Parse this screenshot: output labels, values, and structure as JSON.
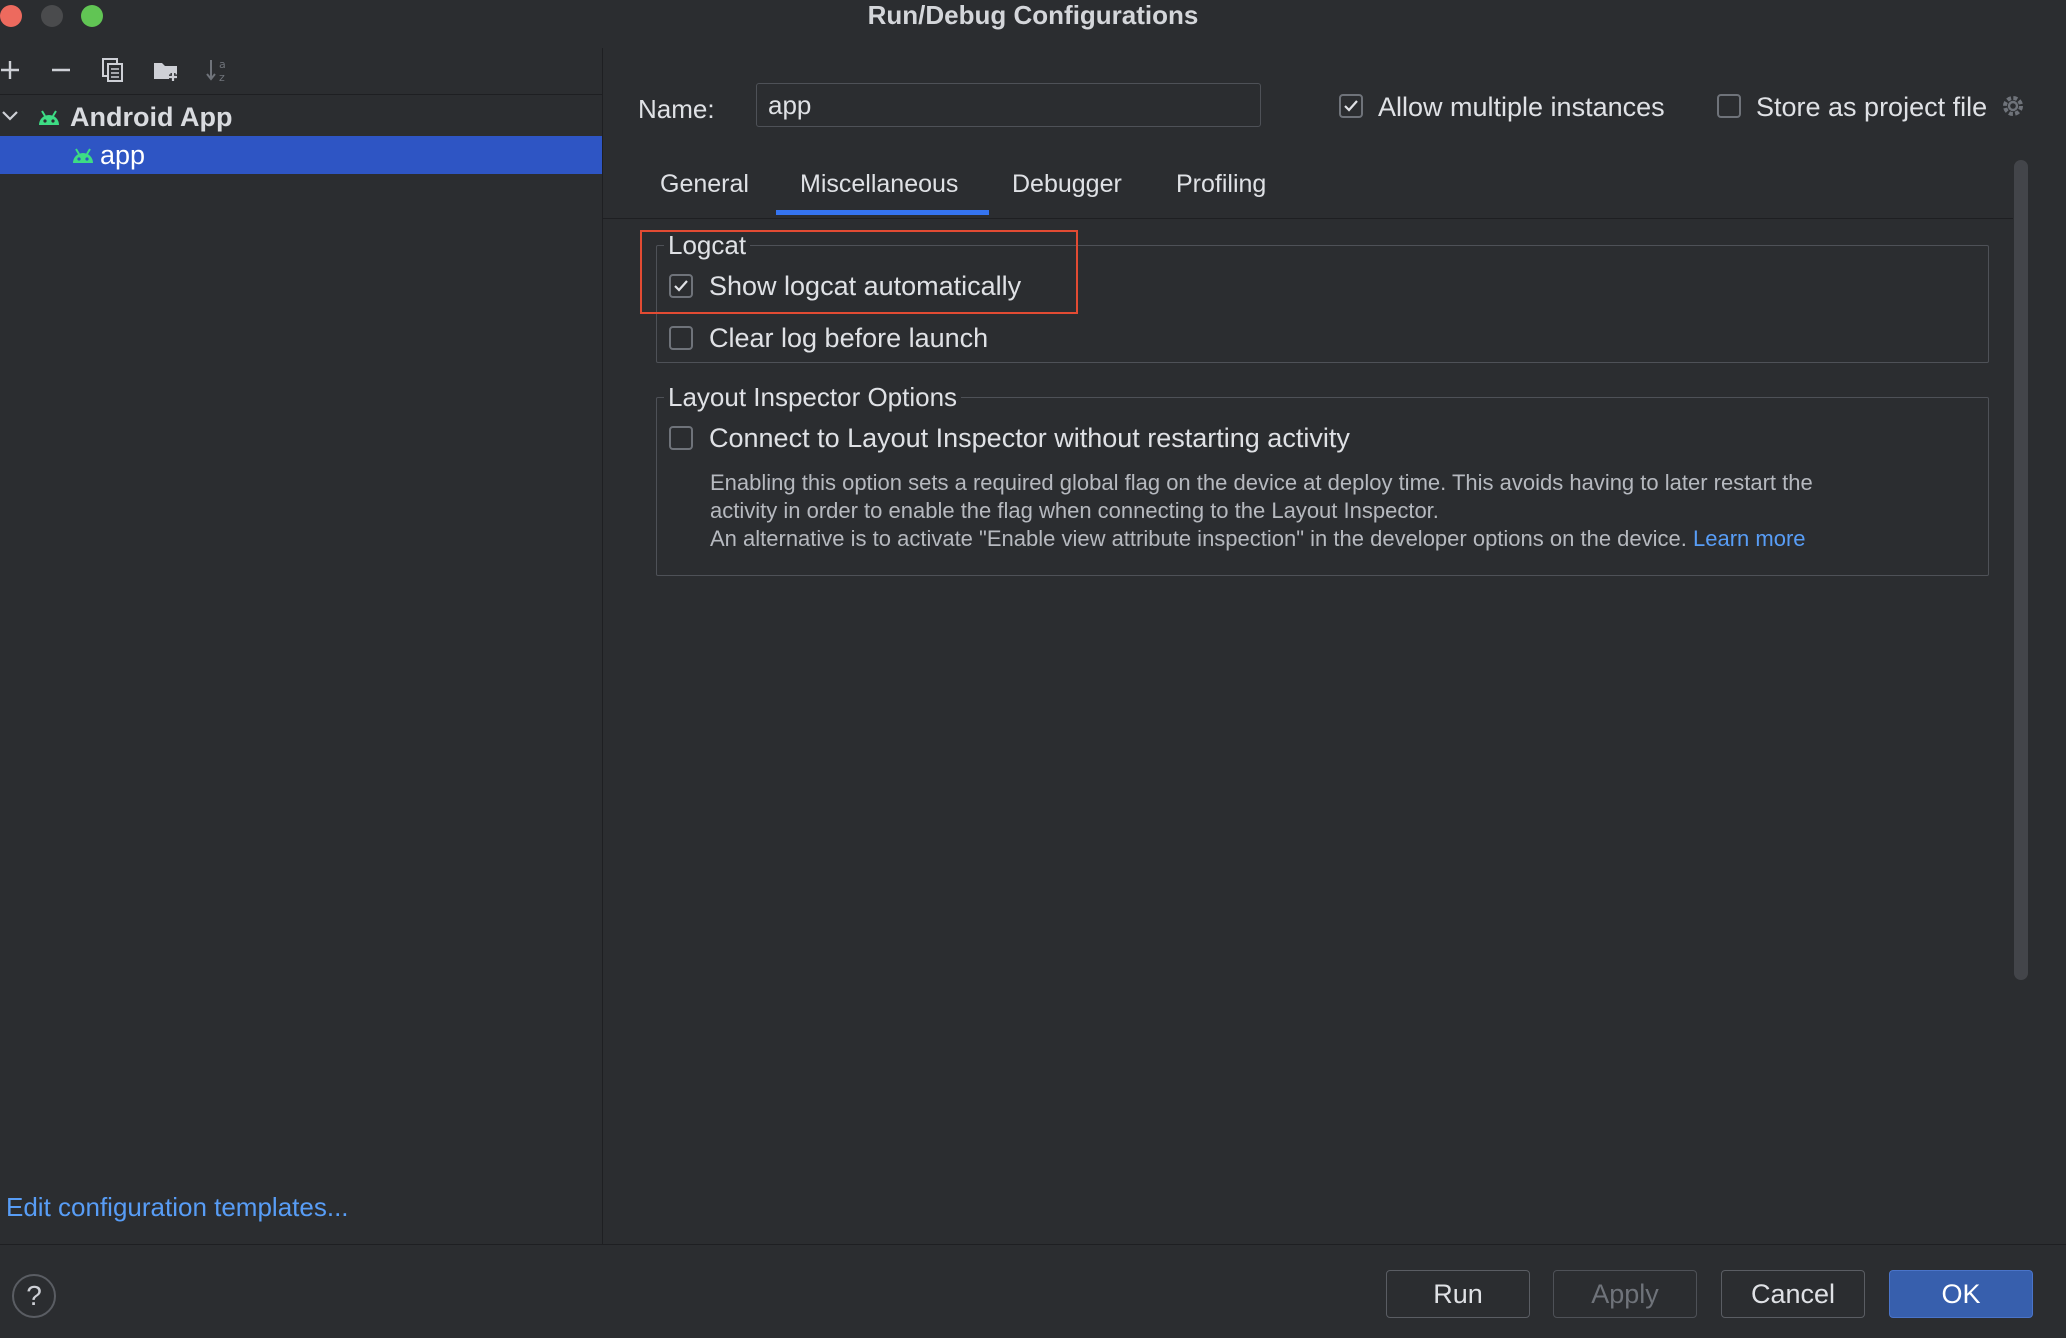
{
  "window": {
    "title": "Run/Debug Configurations"
  },
  "toolbar": {
    "icons": [
      "add-icon",
      "remove-icon",
      "copy-icon",
      "new-folder-icon",
      "sort-icon"
    ]
  },
  "tree": {
    "group_label": "Android App",
    "item_label": "app"
  },
  "left_footer": {
    "edit_templates": "Edit configuration templates..."
  },
  "config": {
    "name_label": "Name:",
    "name_value": "app",
    "allow_multiple_label": "Allow multiple instances",
    "allow_multiple_checked": true,
    "store_project_label": "Store as project file",
    "store_project_checked": false
  },
  "tabs": [
    "General",
    "Miscellaneous",
    "Debugger",
    "Profiling"
  ],
  "active_tab": "Miscellaneous",
  "logcat": {
    "legend": "Logcat",
    "show_auto_label": "Show logcat automatically",
    "show_auto_checked": true,
    "clear_log_label": "Clear log before launch",
    "clear_log_checked": false
  },
  "layout_inspector": {
    "legend": "Layout Inspector Options",
    "connect_label": "Connect to Layout Inspector without restarting activity",
    "connect_checked": false,
    "desc_line1": "Enabling this option sets a required global flag on the device at deploy time. This avoids having to later restart the",
    "desc_line2": "activity in order to enable the flag when connecting to the Layout Inspector.",
    "desc_line3": "An alternative is to activate \"Enable view attribute inspection\" in the developer options on the device.",
    "learn_more": "Learn more"
  },
  "buttons": {
    "run": "Run",
    "apply": "Apply",
    "cancel": "Cancel",
    "ok": "OK"
  },
  "colors": {
    "background": "#2b2d30",
    "selection": "#2e55c4",
    "accent": "#3574f0",
    "link": "#589df6",
    "highlight": "#e24b33",
    "android_green": "#3ddc84"
  }
}
